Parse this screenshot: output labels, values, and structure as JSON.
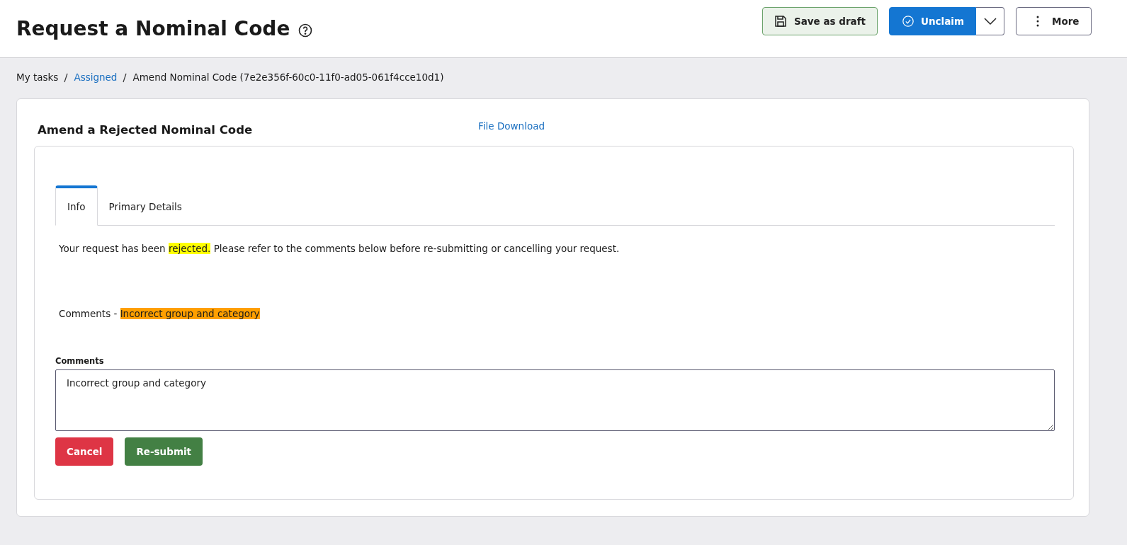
{
  "header": {
    "title": "Request a Nominal Code",
    "actions": [
      {
        "kind": "draft",
        "label": "Save as draft"
      },
      {
        "kind": "primary",
        "label": "Unclaim"
      },
      {
        "kind": "more",
        "label": "More"
      }
    ]
  },
  "breadcrumb": [
    {
      "label": "My tasks",
      "kind": "text"
    },
    {
      "label": "Assigned",
      "kind": "link"
    },
    {
      "label": "Amend Nominal Code (7e2e356f-60c0-11f0-ad05-061f4cce10d1)",
      "kind": "text"
    }
  ],
  "card": {
    "title": "Amend a Rejected Nominal Code",
    "link": "File Download",
    "tabs": [
      {
        "label": "Info",
        "selected": true
      },
      {
        "label": "Primary Details",
        "selected": false
      }
    ],
    "message": {
      "before": "Your request has been ",
      "highlight": "rejected.",
      "after": " Please refer to the comments below before re-submitting or cancelling your request."
    },
    "comment_line": {
      "before": "Comments - ",
      "highlight": "Incorrect group and category"
    },
    "comments_field": {
      "label": "Comments",
      "value": "Incorrect group and category"
    },
    "buttons": [
      {
        "kind": "danger",
        "label": "Cancel"
      },
      {
        "kind": "success",
        "label": "Re-submit"
      }
    ]
  }
}
